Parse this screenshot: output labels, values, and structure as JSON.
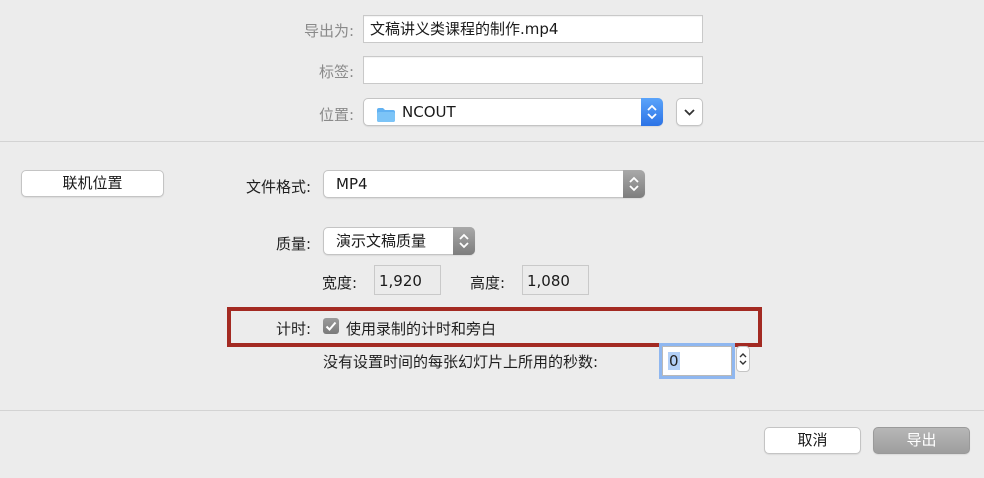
{
  "export_as": {
    "label": "导出为:",
    "value": "文稿讲义类课程的制作.mp4"
  },
  "tags": {
    "label": "标签:",
    "value": ""
  },
  "location": {
    "label": "位置:",
    "value": "NCOUT",
    "icon": "folder-icon"
  },
  "online_locations_button": "联机位置",
  "file_format": {
    "label": "文件格式:",
    "value": "MP4"
  },
  "quality": {
    "label": "质量:",
    "value": "演示文稿质量"
  },
  "width": {
    "label": "宽度:",
    "value": "1,920"
  },
  "height": {
    "label": "高度:",
    "value": "1,080"
  },
  "timing": {
    "label": "计时:",
    "checkbox_label": "使用录制的计时和旁白",
    "checked": true
  },
  "seconds": {
    "label": "没有设置时间的每张幻灯片上所用的秒数:",
    "value": "0"
  },
  "buttons": {
    "cancel": "取消",
    "export": "导出"
  },
  "colors": {
    "accent_blue": "#2c73e6",
    "highlight_border": "#a32a22"
  }
}
